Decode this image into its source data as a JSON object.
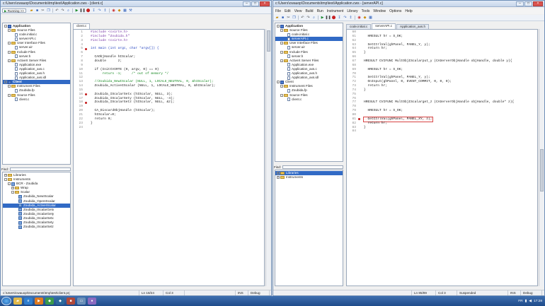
{
  "left": {
    "title": "c:\\Users\\cwauop\\Documents\\tmp\\test\\Application.cws - [client.c]",
    "toolbar_combo": "Running >>",
    "tree": [
      {
        "label": "Application",
        "type": "app",
        "bold": true,
        "exp": "-",
        "indent": 0
      },
      {
        "label": "Source Files",
        "type": "folder",
        "exp": "-",
        "indent": 1
      },
      {
        "label": "code.initial.c",
        "type": "file",
        "indent": 2
      },
      {
        "label": "serverAPI.c",
        "type": "file",
        "indent": 2
      },
      {
        "label": "User Interface Files",
        "type": "folder",
        "exp": "-",
        "indent": 1
      },
      {
        "label": "server.uir",
        "type": "file",
        "indent": 2
      },
      {
        "label": "Include Files",
        "type": "folder",
        "exp": "-",
        "indent": 1
      },
      {
        "label": "server.h",
        "type": "file",
        "indent": 2
      },
      {
        "label": "ActiveX Server Files",
        "type": "folder",
        "exp": "-",
        "indent": 1
      },
      {
        "label": "Application.exe",
        "type": "file",
        "indent": 2
      },
      {
        "label": "Application_axs.c",
        "type": "file",
        "indent": 2
      },
      {
        "label": "Application_axs.h",
        "type": "file",
        "indent": 2
      },
      {
        "label": "Application_axs.idl",
        "type": "file",
        "indent": 2
      },
      {
        "label": "Client",
        "type": "app",
        "bold": true,
        "exp": "-",
        "indent": 0,
        "selected": true
      },
      {
        "label": "Instrument Files",
        "type": "folder",
        "exp": "-",
        "indent": 1
      },
      {
        "label": "Zoubida.fp",
        "type": "file",
        "indent": 2
      },
      {
        "label": "Source Files",
        "type": "folder",
        "exp": "-",
        "indent": 1
      },
      {
        "label": "client.c",
        "type": "file",
        "indent": 2
      }
    ],
    "find_label": "Find:",
    "lib_tree": [
      {
        "label": "Libraries",
        "type": "folder",
        "exp": "+",
        "indent": 0
      },
      {
        "label": "Instruments",
        "type": "folder",
        "exp": "-",
        "indent": 0
      },
      {
        "label": "BCR - Zoubida",
        "type": "inst",
        "exp": "-",
        "indent": 1
      },
      {
        "label": "Wrap",
        "type": "folder",
        "exp": "+",
        "indent": 2
      },
      {
        "label": "Scalar",
        "type": "folder",
        "exp": "-",
        "indent": 2
      },
      {
        "label": "Zoubida_NewIScalar",
        "type": "fn",
        "indent": 3
      },
      {
        "label": "Zoubida_OpenIScalar",
        "type": "fn",
        "indent": 3
      },
      {
        "label": "Zoubida_ActiveIScalar",
        "type": "fn",
        "indent": 3,
        "selected": true
      },
      {
        "label": "Zoubida_IScalarGetx",
        "type": "fn",
        "indent": 3
      },
      {
        "label": "Zoubida_IScalarGety",
        "type": "fn",
        "indent": 3
      },
      {
        "label": "Zoubida_IScalarSetx",
        "type": "fn",
        "indent": 3
      },
      {
        "label": "Zoubida_IScalarSety",
        "type": "fn",
        "indent": 3
      },
      {
        "label": "Zoubida_IScalarSetz",
        "type": "fn",
        "indent": 3
      }
    ],
    "tabs": [
      "client.c"
    ],
    "code": [
      {
        "n": "1",
        "t": "#include <cvirte.h>",
        "c": "dir"
      },
      {
        "n": "2",
        "t": "#include \"Zoubida.h\"",
        "c": "dir"
      },
      {
        "n": "3",
        "t": "#include <cvirte.h>",
        "c": "dir"
      },
      {
        "n": "4",
        "t": "",
        "c": ""
      },
      {
        "n": "5",
        "t": "int main (int argc, char *argv[]) {",
        "c": "kw",
        "bp": true
      },
      {
        "n": "6",
        "t": "",
        "c": ""
      },
      {
        "n": "7",
        "t": "  CAObjHandle hIScalar;",
        "c": ""
      },
      {
        "n": "8",
        "t": "  double      z;",
        "c": ""
      },
      {
        "n": "9",
        "t": "",
        "c": ""
      },
      {
        "n": "10",
        "t": "  if (InitCVIRTE (0, argv, 0) == 0)",
        "c": ""
      },
      {
        "n": "11",
        "t": "      return -1;     /* out of memory */",
        "c": "cm"
      },
      {
        "n": "12",
        "t": "",
        "c": ""
      },
      {
        "n": "13",
        "t": "  //Zoubida_NewIScalar (NULL, 1, LOCALE_NEUTRAL, 0, &hIScalar);",
        "c": "cm"
      },
      {
        "n": "14",
        "t": "  Zoubida_ActiveIScalar (NULL, 1, LOCALE_NEUTRAL, 0, &hIScalar);",
        "c": ""
      },
      {
        "n": "15",
        "t": "",
        "c": ""
      },
      {
        "n": "16",
        "t": "  Zoubida_IScalarSetx (hIScalar, NULL, 3);",
        "c": "",
        "bp": true
      },
      {
        "n": "17",
        "t": "  Zoubida_IScalarSety (hIScalar, NULL, -4);",
        "c": ""
      },
      {
        "n": "18",
        "t": "  Zoubida_IScalarGetz (hIScalar, NULL, &z);",
        "c": "",
        "bp": true
      },
      {
        "n": "19",
        "t": "",
        "c": ""
      },
      {
        "n": "20",
        "t": "  CA_DiscardObjHandle (hIScalar);",
        "c": ""
      },
      {
        "n": "21",
        "t": "  hIScalar=0;",
        "c": ""
      },
      {
        "n": "22",
        "t": "  return 0;",
        "c": ""
      },
      {
        "n": "23",
        "t": "}",
        "c": ""
      },
      {
        "n": "24",
        "t": "",
        "c": ""
      }
    ],
    "status": {
      "path": "c:\\Users\\cwauop\\Documents\\tmp\\test\\client.prj",
      "pos": "Ln 18/24",
      "col": "Col 3",
      "ins": "INS",
      "mode": "Debug"
    }
  },
  "right": {
    "title": "c:\\Users\\cwauop\\Documents\\tmp\\test\\Application.cws - [serverAPI.c]",
    "menu": [
      "File",
      "Edit",
      "View",
      "Build",
      "Run",
      "Instrument",
      "Library",
      "Tools",
      "Window",
      "Options",
      "Help"
    ],
    "tree": [
      {
        "label": "Application",
        "type": "app",
        "bold": true,
        "exp": "-",
        "indent": 0
      },
      {
        "label": "Source Files",
        "type": "folder",
        "exp": "-",
        "indent": 1
      },
      {
        "label": "code.initial.c",
        "type": "file",
        "indent": 2
      },
      {
        "label": "serverAPI.c",
        "type": "file",
        "indent": 2,
        "selected": true
      },
      {
        "label": "User Interface Files",
        "type": "folder",
        "exp": "-",
        "indent": 1
      },
      {
        "label": "server.uir",
        "type": "file",
        "indent": 2
      },
      {
        "label": "Include Files",
        "type": "folder",
        "exp": "-",
        "indent": 1
      },
      {
        "label": "server.h",
        "type": "file",
        "indent": 2
      },
      {
        "label": "ActiveX Server Files",
        "type": "folder",
        "exp": "-",
        "indent": 1
      },
      {
        "label": "Application.exe",
        "type": "file",
        "indent": 2
      },
      {
        "label": "Application_axs.c",
        "type": "file",
        "indent": 2
      },
      {
        "label": "Application_axs.h",
        "type": "file",
        "indent": 2
      },
      {
        "label": "Application_axs.idl",
        "type": "file",
        "indent": 2
      },
      {
        "label": "Client",
        "type": "app",
        "exp": "-",
        "indent": 0
      },
      {
        "label": "Instrument Files",
        "type": "folder",
        "exp": "-",
        "indent": 1
      },
      {
        "label": "Zoubida.fp",
        "type": "file",
        "indent": 2
      },
      {
        "label": "Source Files",
        "type": "folder",
        "exp": "-",
        "indent": 1
      },
      {
        "label": "client.c",
        "type": "file",
        "indent": 2
      }
    ],
    "find_label": "Find:",
    "lib_tree": [
      {
        "label": "Libraries",
        "type": "folder",
        "exp": "+",
        "indent": 0,
        "selected": true
      },
      {
        "label": "Instruments",
        "type": "folder",
        "exp": "+",
        "indent": 0
      }
    ],
    "tabs": [
      "code.initial.c",
      "serverAPI.c",
      "Application_axs.h"
    ],
    "code": [
      {
        "n": "60",
        "t": "",
        "c": ""
      },
      {
        "n": "61",
        "t": "  HRESULT hr = S_OK;",
        "c": ""
      },
      {
        "n": "62",
        "t": "",
        "c": ""
      },
      {
        "n": "63",
        "t": "  SetCtrlVal(ghPanel, PANEL_Y, y);",
        "c": ""
      },
      {
        "n": "64",
        "t": "  return hr;",
        "c": ""
      },
      {
        "n": "65",
        "t": "}",
        "c": ""
      },
      {
        "n": "66",
        "t": "",
        "c": ""
      },
      {
        "n": "67",
        "t": "HRESULT CVIFUNC MultObjIScalarput_y (CAServerObjHandle objHandle, double y){",
        "c": ""
      },
      {
        "n": "68",
        "t": "",
        "c": ""
      },
      {
        "n": "69",
        "t": "  HRESULT hr = S_OK;",
        "c": ""
      },
      {
        "n": "70",
        "t": "",
        "c": ""
      },
      {
        "n": "71",
        "t": "  SetCtrlVal(ghPanel, PANEL_Y, y);",
        "c": ""
      },
      {
        "n": "72",
        "t": "  OnInput(ghPanel, 0, EVENT_COMMIT, 0, 0, 0);",
        "c": ""
      },
      {
        "n": "73",
        "t": "  return hr;",
        "c": ""
      },
      {
        "n": "74",
        "t": "}",
        "c": ""
      },
      {
        "n": "75",
        "t": "",
        "c": ""
      },
      {
        "n": "76",
        "t": "",
        "c": ""
      },
      {
        "n": "77",
        "t": "HRESULT CVIFUNC MultObjIScalarget_z (CAServerObjHandle objHandle, double* z){",
        "c": ""
      },
      {
        "n": "78",
        "t": "",
        "c": ""
      },
      {
        "n": "79",
        "t": "  HRESULT hr = S_OK;",
        "c": ""
      },
      {
        "n": "80",
        "t": "",
        "c": ""
      },
      {
        "n": "81",
        "t": "  GetCtrlVal(ghPanel, PANEL_XY, z);",
        "c": "hl",
        "bp": true
      },
      {
        "n": "82",
        "t": "  return hr;",
        "c": ""
      },
      {
        "n": "83",
        "t": "}",
        "c": ""
      },
      {
        "n": "84",
        "t": "",
        "c": ""
      }
    ],
    "status": {
      "pos": "Ln 85/89",
      "col": "Col 3",
      "state": "Suspended",
      "ins": "INS",
      "mode": "Debug"
    }
  },
  "taskbar": {
    "lang": "FR",
    "time": "17:28"
  },
  "colors": {
    "accent": "#316ac5",
    "breakpoint": "#c41a1a",
    "comment": "#188a23",
    "directive": "#7a3aa8",
    "keyword": "#1f3fbf"
  }
}
